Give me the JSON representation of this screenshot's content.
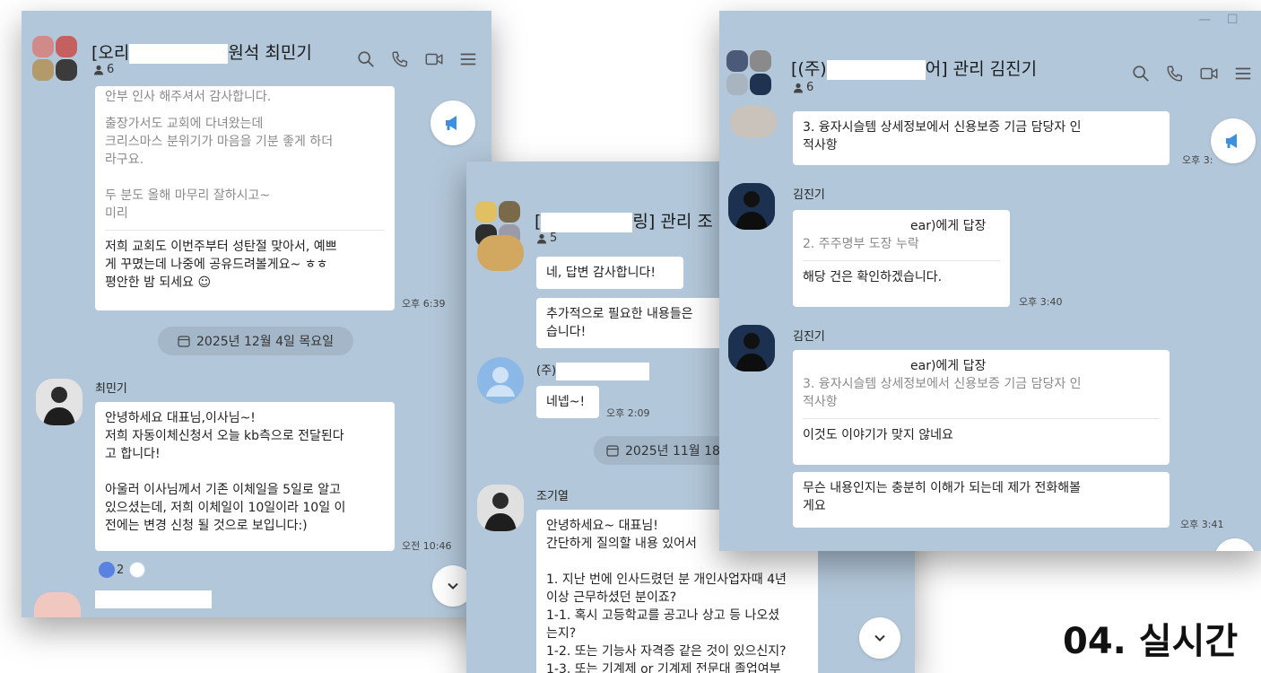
{
  "corner_label": "04. 실시간",
  "icons": [
    "search-icon",
    "phone-icon",
    "video-icon",
    "menu-icon",
    "notice-megaphone-icon",
    "chevron-down-icon",
    "person-icon",
    "calendar-icon"
  ],
  "colors": {
    "chat_bg": "#b2c7d9",
    "bubble": "#ffffff",
    "notice_icon": "#3d8fe0",
    "reaction": "#5a82e0"
  },
  "window_left": {
    "title_prefix": "[오리",
    "title_suffix": "원석 최민기",
    "members": "6",
    "messages": [
      {
        "line_top": "안부 인사 해주셔서 감사합니다.",
        "quoted": [
          "출장가서도 교회에 다녀왔는데",
          "크리스마스 분위기가 마음을 기분 좋게 하더",
          "라구요.",
          "",
          "두 분도 올해 마무리 잘하시고~",
          "미리"
        ],
        "reply": [
          "저희 교회도 이번주부터 성탄절 맞아서, 예쁘",
          "게 꾸몄는데 나중에 공유드려볼게요~ ㅎㅎ",
          "평안한 밤 되세요 ☺"
        ],
        "time": "오후 6:39"
      }
    ],
    "date_divider": "2025년 12월 4일 목요일",
    "sender": "최민기",
    "message2": [
      "안녕하세요 대표님,이사님~!",
      "저희 자동이체신청서 오늘 kb측으로 전달된다",
      "고 합니다!",
      "",
      "아울러 이사님께서 기존 이체일을 5일로 알고",
      "있으셨는데, 저희 이체일이 10일이라 10일 이",
      "전에는 변경 신청 될 것으로 보입니다:)"
    ],
    "message2_time": "오전 10:46",
    "reaction_count": "2"
  },
  "window_middle": {
    "title_prefix": "[",
    "title_suffix": "링] 관리 조",
    "members": "5",
    "msg1": "네, 답변 감사합니다!",
    "msg2": [
      "추가적으로 필요한 내용들은 ",
      "습니다!"
    ],
    "sender_prefix": "(주)",
    "msg3": "네넵~!",
    "msg3_time": "오후 2:09",
    "date_divider": "2025년 11월 18",
    "sender2": "조기열",
    "msg4": [
      "안녕하세요~ 대표님!",
      "간단하게 질의할 내용 있어서",
      "",
      "1. 지난 번에 인사드렸던 분 개인사업자때 4년",
      " 이상 근무하셨던 분이죠?",
      "1-1. 혹시 고등학교를 공고나 상고 등 나오셨",
      "는지?",
      "1-2. 또는 기능사 자격증 같은 것이 있으신지?",
      "1-3. 또는 기계제 or 기계제 전문대 졸업여부"
    ]
  },
  "window_right": {
    "title_prefix": "[(주)",
    "title_suffix": "어] 관리 김진기",
    "members": "6",
    "msg1": [
      "3. 융자시슬템 상세정보에서 신용보증 기금 담당자 인",
      "적사항"
    ],
    "msg1_time": "오후 3:",
    "sender": "김진기",
    "reply1_to": "ear)에게 답장",
    "reply1_quote": "2. 주주명부 도장 누락",
    "reply1_text": "해당 건은 확인하겠습니다.",
    "reply1_time": "오후 3:40",
    "sender2": "김진기",
    "reply2_to": "ear)에게 답장",
    "reply2_quote": [
      "3. 융자시슬템 상세정보에서 신용보증 기금 담당자 인",
      "적사항"
    ],
    "reply2_text": "이것도 이야기가 맞지 않네요",
    "msg3": [
      "무슨 내용인지는 충분히 이해가 되는데 제가 전화해볼",
      "게요"
    ],
    "msg3_time": "오후 3:41"
  }
}
